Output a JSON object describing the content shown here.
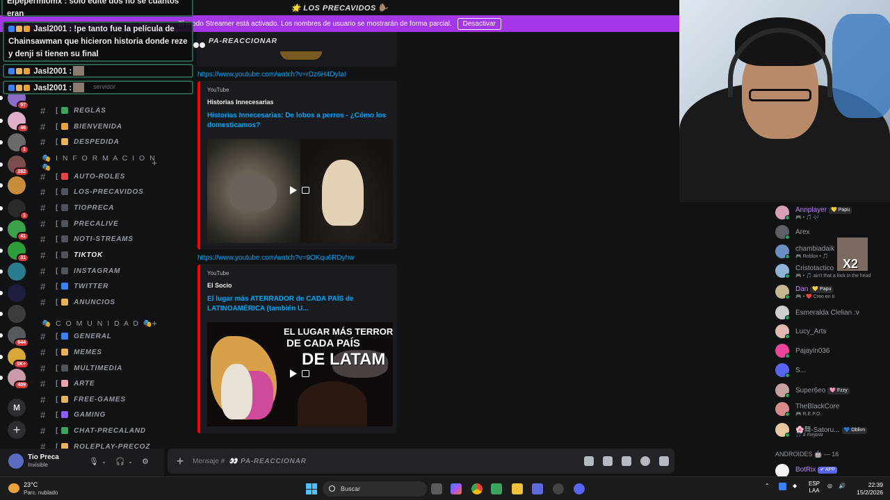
{
  "window": {
    "server_title": "🌟 LOS PRECAVIDOS 🦫"
  },
  "streamer_banner": {
    "text": "El modo Streamer está activado. Los nombres de usuario se mostrarán de forma parcial.",
    "button": "Desactivar"
  },
  "overlay_chat": [
    {
      "user": "Elpepermiomx",
      "text": "Elpepermiomx : solo edité dos no se cuántos eran"
    },
    {
      "user": "Jasl2001",
      "text": "Jasl2001 : !pe tanto fue la película de Chainsawman que hicieron historia donde reze y denji si tienen su final"
    },
    {
      "user": "Jasl2001",
      "text": "Jasl2001 :"
    },
    {
      "user": "Jasl2001",
      "text": "Jasl2001 :"
    }
  ],
  "overlay_faded": "servidor",
  "server_rail": [
    {
      "name": "server-1",
      "badge": "97",
      "color": "#8f6cc9"
    },
    {
      "name": "server-2",
      "badge": "46",
      "color": "#e0b0c8"
    },
    {
      "name": "server-3",
      "badge": "1",
      "color": "#6a6a6a"
    },
    {
      "name": "server-4",
      "badge": "282",
      "color": "#7a4c4c"
    },
    {
      "name": "server-5",
      "badge": "",
      "color": "#c88d3a"
    },
    {
      "name": "server-6",
      "badge": "1",
      "color": "#2a2a2a"
    },
    {
      "name": "server-7",
      "badge": "41",
      "color": "#3aa04a"
    },
    {
      "name": "server-8",
      "badge": "31",
      "color": "#2e9d3c"
    },
    {
      "name": "server-9",
      "badge": "",
      "color": "#2a7d8f"
    },
    {
      "name": "server-10",
      "badge": "",
      "color": "#1d1d3d"
    },
    {
      "name": "server-11",
      "badge": "",
      "color": "#3d3d3d"
    },
    {
      "name": "server-12",
      "badge": "644",
      "color": "#56595e"
    },
    {
      "name": "server-13",
      "badge": "1K+",
      "color": "#d9a83a"
    },
    {
      "name": "server-14",
      "badge": "409",
      "color": "#c99aa7"
    }
  ],
  "server_letter": "M",
  "channels": {
    "top": [
      {
        "name": "REGLAS",
        "emoji_color": "#3ba55d"
      },
      {
        "name": "BIENVENIDA",
        "emoji_color": "#e8a23c"
      },
      {
        "name": "DESPEDIDA",
        "emoji_color": "#e8b35c"
      }
    ],
    "cat_info": "🎭 I N F O R M A C I O N 🎭",
    "info": [
      {
        "name": "AUTO-ROLES",
        "emoji_color": "#ed4245",
        "active": false
      },
      {
        "name": "LOS-PRECAVIDOS",
        "emoji_color": "#4f545c",
        "active": false
      },
      {
        "name": "TIOPRECA",
        "emoji_color": "#4f545c",
        "active": false
      },
      {
        "name": "PRECALIVE",
        "emoji_color": "#4f545c",
        "active": false
      },
      {
        "name": "NOTI-STREAMS",
        "emoji_color": "#4f545c",
        "active": false
      },
      {
        "name": "TIKTOK",
        "emoji_color": "#4f545c",
        "active": true
      },
      {
        "name": "INSTAGRAM",
        "emoji_color": "#4f545c",
        "active": false
      },
      {
        "name": "TWITTER",
        "emoji_color": "#3b82f6",
        "active": false
      },
      {
        "name": "ANUNCIOS",
        "emoji_color": "#e8b35c",
        "active": false
      }
    ],
    "cat_com": "🎭 C O M U N I D A D 🎭",
    "com": [
      {
        "name": "GENERAL",
        "emoji_color": "#3b82f6"
      },
      {
        "name": "MEMES",
        "emoji_color": "#e8b35c"
      },
      {
        "name": "MULTIMEDIA",
        "emoji_color": "#4f545c"
      },
      {
        "name": "ARTE",
        "emoji_color": "#e8a2b0"
      },
      {
        "name": "FREE-GAMES",
        "emoji_color": "#e8b35c"
      },
      {
        "name": "GAMING",
        "emoji_color": "#8b5cf6"
      },
      {
        "name": "CHAT-PRECALAND",
        "emoji_color": "#3ba55d"
      },
      {
        "name": "ROLEPLAY-PRECOZ",
        "emoji_color": "#e8b35c"
      }
    ]
  },
  "channel_header": "👀 PA-REACCIONAR",
  "messages": [
    {
      "link": "https://www.youtube.com/watch?v=rDz6H4DyIaI",
      "provider": "YouTube",
      "author": "Historias Innecesarias",
      "title": "Historias Innecesarias: De lobos a perros - ¿Cómo los domesticamos?"
    },
    {
      "link": "https://www.youtube.com/watch?v=9OKqu6RDyhw",
      "provider": "YouTube",
      "author": "El Socio",
      "title": "El lugar más ATERRADOR de CADA PAÍS de LATINOAMÉRICA (también U...",
      "thumb_line1": "EL LUGAR MÁS TERRORÍFICO",
      "thumb_line2": "DE CADA PAÍS",
      "thumb_line3": "DE LATAM"
    }
  ],
  "composer": {
    "placeholder": "Mensaje #",
    "channel": "👀 PA-REACCIONAR"
  },
  "user_panel": {
    "name": "Tio Preca",
    "status": "Invisible"
  },
  "members": [
    {
      "name": "Annplayer",
      "tag": "💛 Papu",
      "sub": "🎮 • 🎵 🎶",
      "color": "#c084fc",
      "av": "#d8a0b8"
    },
    {
      "name": "Arex",
      "tag": "",
      "sub": "",
      "color": "#949ba4",
      "av": "#5c5f66"
    },
    {
      "name": "chambiadaik",
      "tag": "",
      "sub": "🎮 Roblox • 🎵",
      "color": "#949ba4",
      "av": "#6a8fc4"
    },
    {
      "name": "Cristotactico",
      "tag": "",
      "sub": "🎮 • 🎵 ain't that a kick in the head",
      "color": "#949ba4",
      "av": "#8fb4d8"
    },
    {
      "name": "Dan",
      "tag": "💛 Papu",
      "sub": "🎮 • ❤️ Creo en ti",
      "color": "#c084fc",
      "av": "#c8b890"
    },
    {
      "name": "Esmeralda Clelian :v",
      "tag": "",
      "sub": "",
      "color": "#949ba4",
      "av": "#cfcfcf"
    },
    {
      "name": "Lucy_Arts",
      "tag": "",
      "sub": "",
      "color": "#949ba4",
      "av": "#e0b8b0"
    },
    {
      "name": "Pajayin036",
      "tag": "",
      "sub": "",
      "color": "#949ba4",
      "av": "#eb459e"
    },
    {
      "name": "S...",
      "tag": "",
      "sub": "",
      "color": "#949ba4",
      "av": "#5865f2"
    },
    {
      "name": "Super6eo",
      "tag": "🩷 Fzzy",
      "sub": "",
      "color": "#949ba4",
      "av": "#c9a0a0"
    },
    {
      "name": "TheBlackCore",
      "tag": "",
      "sub": "🎮 R.E.P.O.",
      "color": "#949ba4",
      "av": "#d88a8a"
    },
    {
      "name": "🌸舞-Satoru...",
      "tag": "💙 Oblivn",
      "sub": "🎵 a mejorar",
      "color": "#949ba4",
      "av": "#e8c8a0"
    }
  ],
  "member_category": "ANDROIDES 🤖 — 16",
  "member_bot": {
    "name": "BotRix",
    "tag": "✔ APP",
    "color": "#c084fc"
  },
  "cam_overlay": "X2",
  "taskbar": {
    "temp": "23°C",
    "weather": "Parc. nublado",
    "search": "Buscar",
    "lang1": "ESP",
    "lang2": "LAA",
    "time": "22:39",
    "date": "15/2/2026"
  }
}
